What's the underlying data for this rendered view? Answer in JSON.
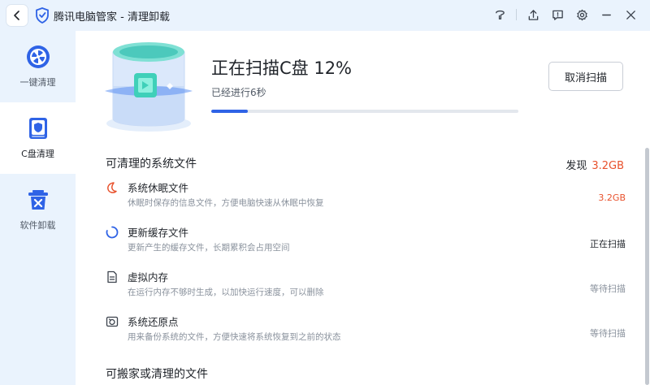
{
  "window": {
    "title": "腾讯电脑管家 - 清理卸载"
  },
  "sidebar": {
    "items": [
      {
        "label": "一键清理"
      },
      {
        "label": "C盘清理"
      },
      {
        "label": "软件卸载"
      }
    ]
  },
  "scan": {
    "title": "正在扫描C盘 12%",
    "elapsed": "已经进行6秒",
    "progress": 0.12,
    "cancel_label": "取消扫描"
  },
  "cleanable": {
    "title": "可清理的系统文件",
    "found_label": "发现",
    "found_size": "3.2GB",
    "items": [
      {
        "name": "系统休眠文件",
        "desc": "休眠时保存的信息文件，方便电脑快速从休眠中恢复",
        "status": "3.2GB"
      },
      {
        "name": "更新缓存文件",
        "desc": "更新产生的缓存文件，长期累积会占用空间",
        "status": "正在扫描"
      },
      {
        "name": "虚拟内存",
        "desc": "在运行内存不够时生成，以加快运行速度，可以删除",
        "status": "等待扫描"
      },
      {
        "name": "系统还原点",
        "desc": "用来备份系统的文件，方便快速将系统恢复到之前的状态",
        "status": "等待扫描"
      }
    ]
  },
  "movable": {
    "title": "可搬家或清理的文件"
  },
  "colors": {
    "accent": "#2f63e6",
    "size_highlight": "#e8512c",
    "window_bg": "#eaf3fd"
  },
  "icons": {
    "back": "chevron-left-icon",
    "logo": "shield-icon",
    "theme": "skin-icon",
    "upload": "upload-icon",
    "feedback": "message-icon",
    "settings": "gear-icon",
    "minimize": "minimize-icon",
    "close": "close-icon"
  }
}
